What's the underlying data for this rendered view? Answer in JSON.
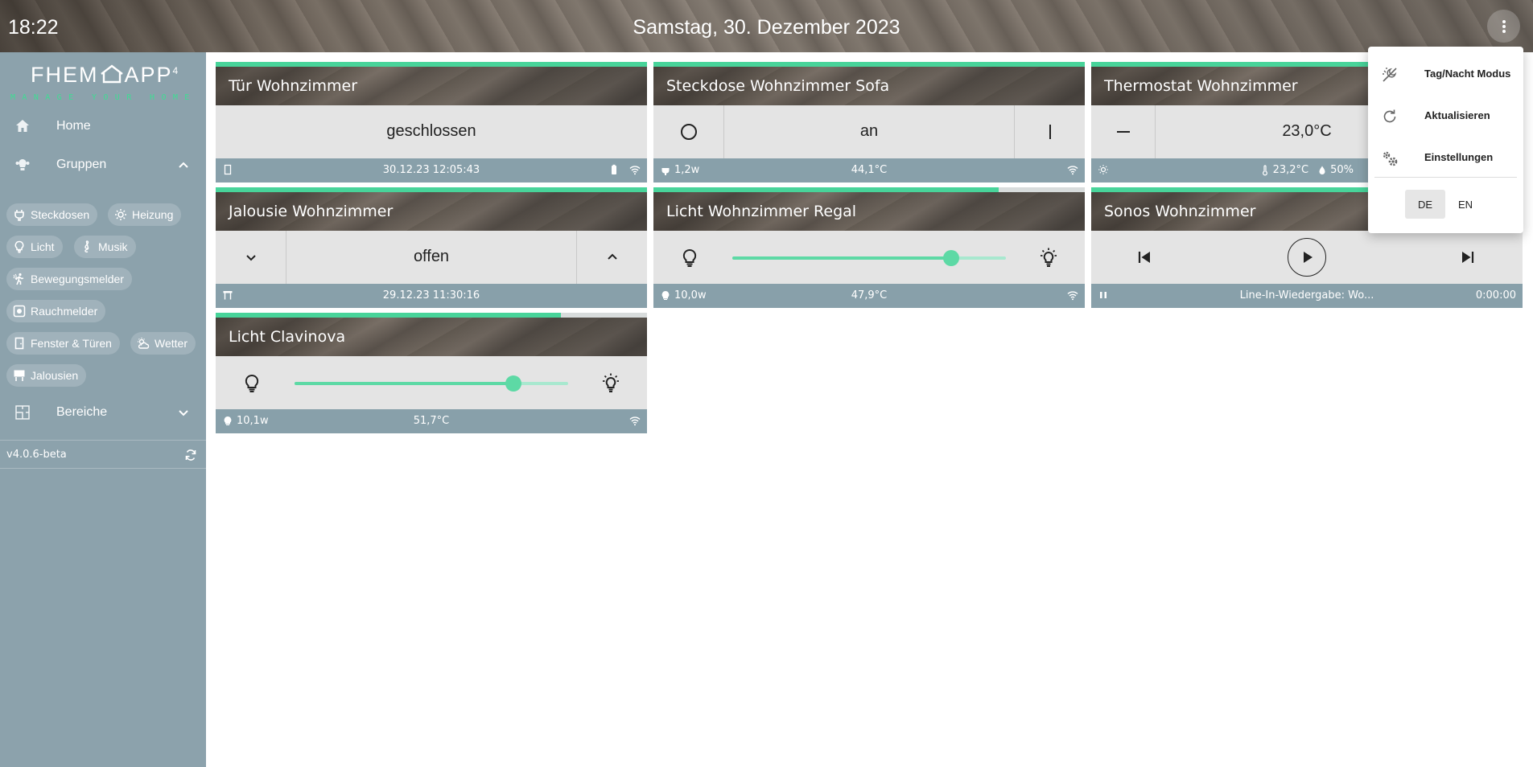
{
  "topbar": {
    "time": "18:22",
    "date": "Samstag, 30. Dezember 2023"
  },
  "sidebar": {
    "logo": {
      "main": "FHEM",
      "app": "APP",
      "version_mark": "4",
      "tagline": "MANAGE YOUR HOME"
    },
    "home_label": "Home",
    "groups_label": "Gruppen",
    "chips": [
      "Steckdosen",
      "Heizung",
      "Licht",
      "Musik",
      "Bewegungsmelder",
      "Rauchmelder",
      "Fenster & Türen",
      "Wetter",
      "Jalousien"
    ],
    "areas_label": "Bereiche",
    "version": "v4.0.6-beta"
  },
  "cards": {
    "door": {
      "title": "Tür Wohnzimmer",
      "state": "geschlossen",
      "footer_center": "30.12.23 12:05:43",
      "progress": 1.0
    },
    "socket": {
      "title": "Steckdose Wohnzimmer Sofa",
      "state": "an",
      "footer_left": "1,2w",
      "footer_center": "44,1°C",
      "progress": 1.0
    },
    "thermostat": {
      "title": "Thermostat Wohnzimmer",
      "state": "23,0°C",
      "temp": "23,2°C",
      "humidity": "50%",
      "progress": 1.0
    },
    "blind": {
      "title": "Jalousie Wohnzimmer",
      "state": "offen",
      "footer_center": "29.12.23 11:30:16",
      "progress": 1.0
    },
    "light_regal": {
      "title": "Licht Wohnzimmer Regal",
      "footer_left": "10,0w",
      "footer_center": "47,9°C",
      "level": 0.8,
      "progress": 0.8
    },
    "sonos": {
      "title": "Sonos Wohnzimmer",
      "footer_center": "Line-In-Wiedergabe: Wo...",
      "footer_right": "0:00:00",
      "progress": 1.0
    },
    "light_clavinova": {
      "title": "Licht Clavinova",
      "footer_left": "10,1w",
      "footer_center": "51,7°C",
      "level": 0.8,
      "progress": 0.8
    }
  },
  "menu": {
    "items": [
      "Tag/Nacht Modus",
      "Aktualisieren",
      "Einstellungen"
    ],
    "languages": [
      "DE",
      "EN"
    ],
    "active_language": "DE"
  },
  "colors": {
    "accent": "#48d49a",
    "sidebar": "#8ca2ac",
    "footer": "#88a0aa",
    "card_body": "#e4e4e4"
  }
}
